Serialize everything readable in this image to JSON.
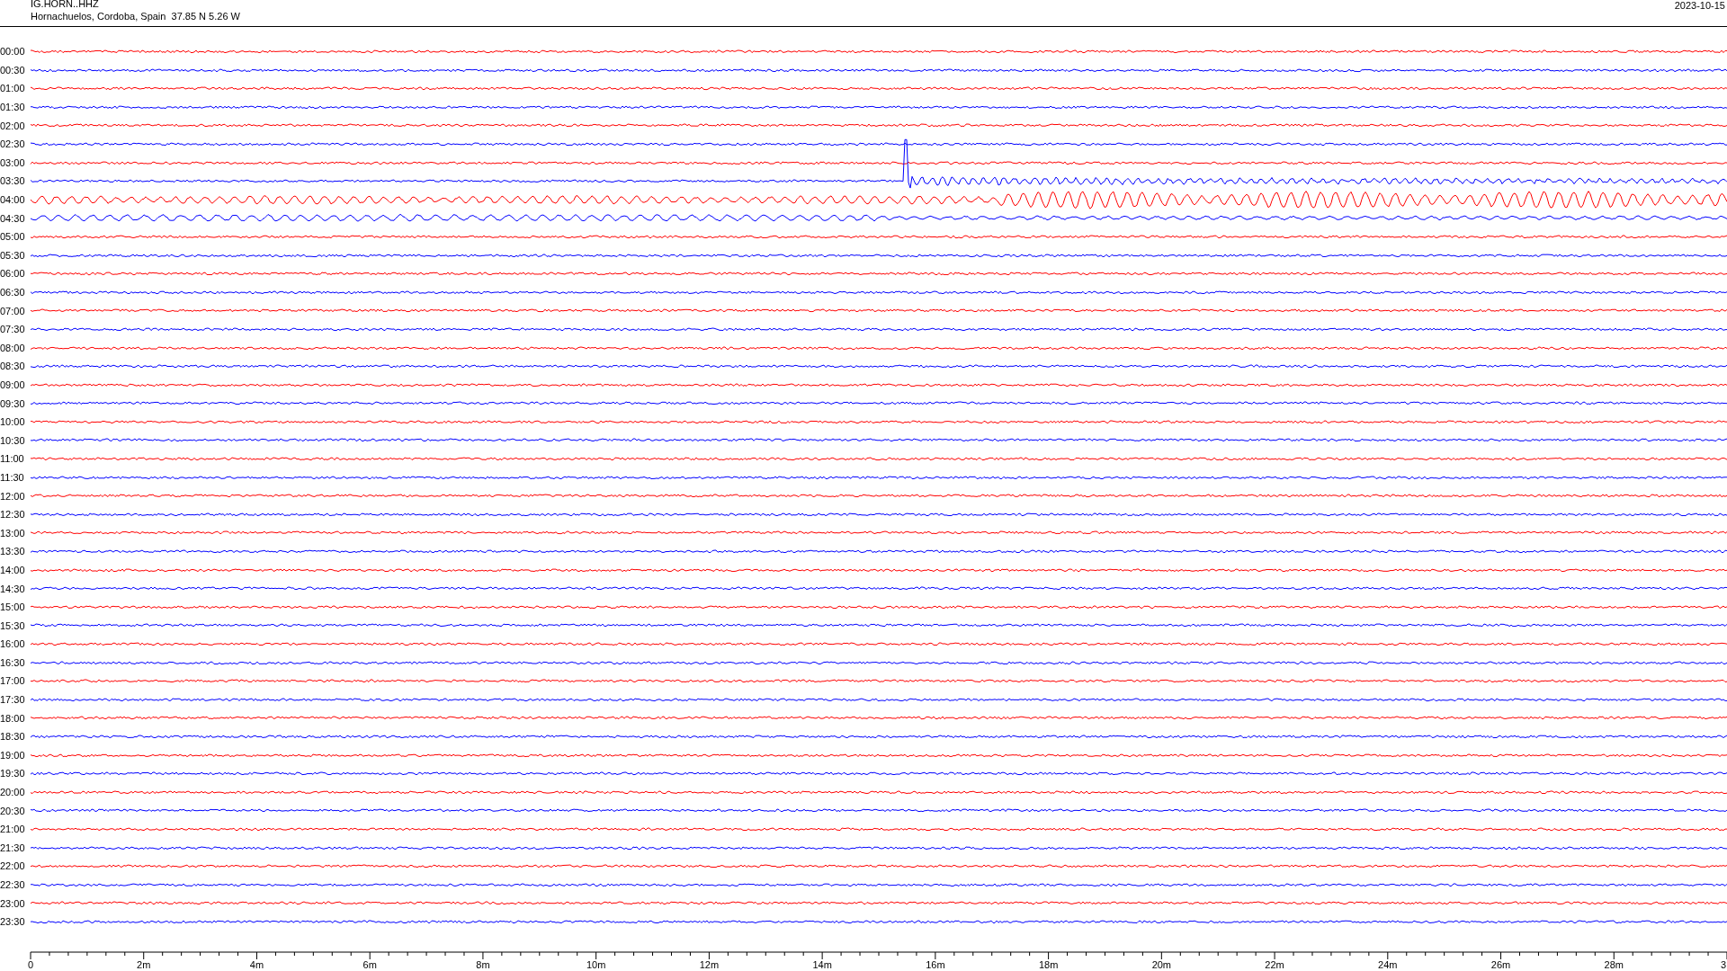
{
  "header": {
    "station": "IG.HORN..HHZ",
    "location": "Hornachuelos, Cordoba, Spain  37.85 N 5.26 W",
    "date": "2023-10-15"
  },
  "rows": [
    {
      "label": "00:00",
      "color": "#ff0000",
      "kind": "quiet"
    },
    {
      "label": "00:30",
      "color": "#0000ff",
      "kind": "quiet"
    },
    {
      "label": "01:00",
      "color": "#ff0000",
      "kind": "quiet"
    },
    {
      "label": "01:30",
      "color": "#0000ff",
      "kind": "quiet"
    },
    {
      "label": "02:00",
      "color": "#ff0000",
      "kind": "quiet"
    },
    {
      "label": "02:30",
      "color": "#0000ff",
      "kind": "quiet"
    },
    {
      "label": "03:00",
      "color": "#ff0000",
      "kind": "quiet"
    },
    {
      "label": "03:30",
      "color": "#0000ff",
      "kind": "onset"
    },
    {
      "label": "04:00",
      "color": "#ff0000",
      "kind": "strong"
    },
    {
      "label": "04:30",
      "color": "#0000ff",
      "kind": "moderate"
    },
    {
      "label": "05:00",
      "color": "#ff0000",
      "kind": "quiet"
    },
    {
      "label": "05:30",
      "color": "#0000ff",
      "kind": "quiet"
    },
    {
      "label": "06:00",
      "color": "#ff0000",
      "kind": "quiet"
    },
    {
      "label": "06:30",
      "color": "#0000ff",
      "kind": "quiet"
    },
    {
      "label": "07:00",
      "color": "#ff0000",
      "kind": "quiet"
    },
    {
      "label": "07:30",
      "color": "#0000ff",
      "kind": "quiet"
    },
    {
      "label": "08:00",
      "color": "#ff0000",
      "kind": "quiet"
    },
    {
      "label": "08:30",
      "color": "#0000ff",
      "kind": "quiet"
    },
    {
      "label": "09:00",
      "color": "#ff0000",
      "kind": "quiet"
    },
    {
      "label": "09:30",
      "color": "#0000ff",
      "kind": "quiet"
    },
    {
      "label": "10:00",
      "color": "#ff0000",
      "kind": "quiet"
    },
    {
      "label": "10:30",
      "color": "#0000ff",
      "kind": "quiet"
    },
    {
      "label": "11:00",
      "color": "#ff0000",
      "kind": "quiet"
    },
    {
      "label": "11:30",
      "color": "#0000ff",
      "kind": "quiet"
    },
    {
      "label": "12:00",
      "color": "#ff0000",
      "kind": "quiet"
    },
    {
      "label": "12:30",
      "color": "#0000ff",
      "kind": "quiet"
    },
    {
      "label": "13:00",
      "color": "#ff0000",
      "kind": "quiet"
    },
    {
      "label": "13:30",
      "color": "#0000ff",
      "kind": "quiet"
    },
    {
      "label": "14:00",
      "color": "#ff0000",
      "kind": "quiet"
    },
    {
      "label": "14:30",
      "color": "#0000ff",
      "kind": "quiet"
    },
    {
      "label": "15:00",
      "color": "#ff0000",
      "kind": "quiet"
    },
    {
      "label": "15:30",
      "color": "#0000ff",
      "kind": "quiet"
    },
    {
      "label": "16:00",
      "color": "#ff0000",
      "kind": "quiet"
    },
    {
      "label": "16:30",
      "color": "#0000ff",
      "kind": "quiet"
    },
    {
      "label": "17:00",
      "color": "#ff0000",
      "kind": "quiet"
    },
    {
      "label": "17:30",
      "color": "#0000ff",
      "kind": "quiet"
    },
    {
      "label": "18:00",
      "color": "#ff0000",
      "kind": "quiet"
    },
    {
      "label": "18:30",
      "color": "#0000ff",
      "kind": "quiet"
    },
    {
      "label": "19:00",
      "color": "#ff0000",
      "kind": "quiet"
    },
    {
      "label": "19:30",
      "color": "#0000ff",
      "kind": "quiet"
    },
    {
      "label": "20:00",
      "color": "#ff0000",
      "kind": "quiet"
    },
    {
      "label": "20:30",
      "color": "#0000ff",
      "kind": "quiet"
    },
    {
      "label": "21:00",
      "color": "#ff0000",
      "kind": "quiet"
    },
    {
      "label": "21:30",
      "color": "#0000ff",
      "kind": "quiet"
    },
    {
      "label": "22:00",
      "color": "#ff0000",
      "kind": "quiet"
    },
    {
      "label": "22:30",
      "color": "#0000ff",
      "kind": "quiet"
    },
    {
      "label": "23:00",
      "color": "#ff0000",
      "kind": "quiet"
    },
    {
      "label": "23:30",
      "color": "#0000ff",
      "kind": "quiet"
    }
  ],
  "x_axis": {
    "ticks": [
      "0",
      "2m",
      "4m",
      "6m",
      "8m",
      "10m",
      "12m",
      "14m",
      "16m",
      "18m",
      "20m",
      "22m",
      "24m",
      "26m",
      "28m",
      "3"
    ]
  }
}
